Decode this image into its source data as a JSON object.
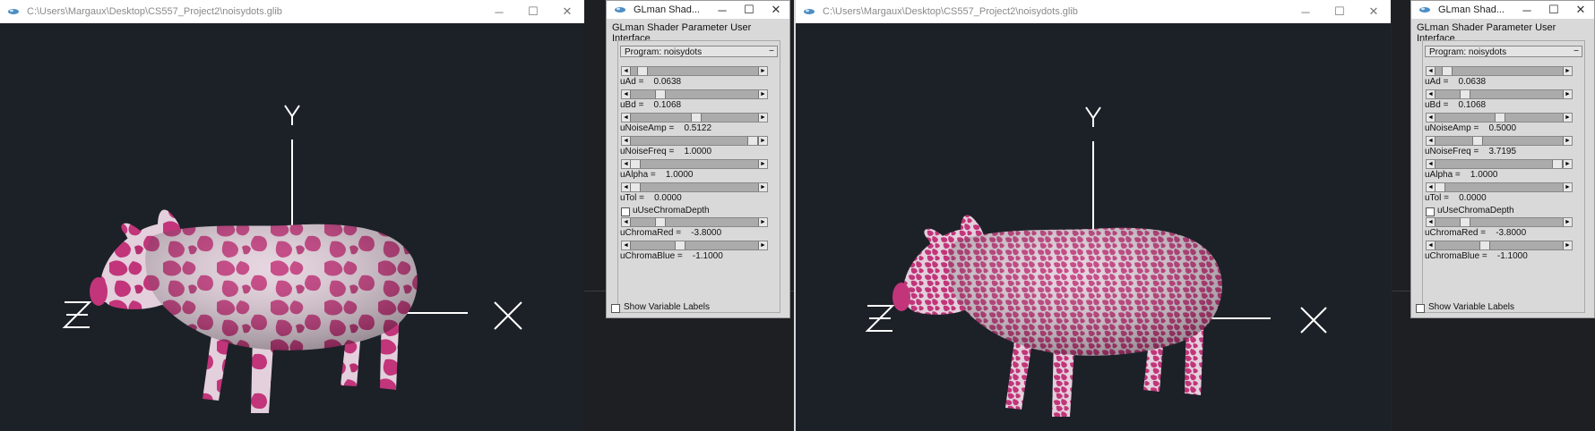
{
  "left": {
    "gl_window": {
      "title": "C:\\Users\\Margaux\\Desktop\\CS557_Project2\\noisydots.glib",
      "axis_x": "X",
      "axis_y": "Y",
      "axis_z": "Z"
    },
    "panel": {
      "title": "GLman Shad...",
      "heading": "GLman Shader Parameter User Interface",
      "program": "Program: noisydots",
      "params": [
        {
          "name": "uAd",
          "value": "0.0638",
          "level": 0.06
        },
        {
          "name": "uBd",
          "value": "0.1068",
          "level": 0.21
        },
        {
          "name": "uNoiseAmp",
          "value": "0.5122",
          "level": 0.51
        },
        {
          "name": "uNoiseFreq",
          "value": "1.0000",
          "level": 0.98
        },
        {
          "name": "uAlpha",
          "value": "1.0000",
          "level": 0.0
        },
        {
          "name": "uTol",
          "value": "0.0000",
          "level": 0.0
        },
        {
          "name": "uChromaRed",
          "value": "-3.8000",
          "level": 0.21
        },
        {
          "name": "uChromaBlue",
          "value": "-1.1000",
          "level": 0.37
        }
      ],
      "use_chroma_depth": "uUseChromaDepth",
      "show_labels": "Show Variable Labels"
    }
  },
  "right": {
    "gl_window": {
      "title": "C:\\Users\\Margaux\\Desktop\\CS557_Project2\\noisydots.glib",
      "axis_x": "X",
      "axis_y": "Y",
      "axis_z": "Z"
    },
    "panel": {
      "title": "GLman Shad...",
      "heading": "GLman Shader Parameter User Interface",
      "program": "Program: noisydots",
      "params": [
        {
          "name": "uAd",
          "value": "0.0638",
          "level": 0.06
        },
        {
          "name": "uBd",
          "value": "0.1068",
          "level": 0.21
        },
        {
          "name": "uNoiseAmp",
          "value": "0.5000",
          "level": 0.5
        },
        {
          "name": "uNoiseFreq",
          "value": "3.7195",
          "level": 0.31
        },
        {
          "name": "uAlpha",
          "value": "1.0000",
          "level": 0.98
        },
        {
          "name": "uTol",
          "value": "0.0000",
          "level": 0.0
        },
        {
          "name": "uChromaRed",
          "value": "-3.8000",
          "level": 0.21
        },
        {
          "name": "uChromaBlue",
          "value": "-1.1000",
          "level": 0.37
        }
      ],
      "use_chroma_depth": "uUseChromaDepth",
      "show_labels": "Show Variable Labels"
    }
  },
  "icons": {
    "app": "glman-window-icon",
    "minimize": "─",
    "maximize": "☐",
    "close": "✕",
    "arrow_left": "◄",
    "arrow_right": "►",
    "collapse": "−"
  },
  "colors": {
    "pig_pink": "#c2357a",
    "pig_white": "#e6d3df",
    "gl_bg": "#1c2127",
    "panel_bg": "#d9d9d9"
  }
}
